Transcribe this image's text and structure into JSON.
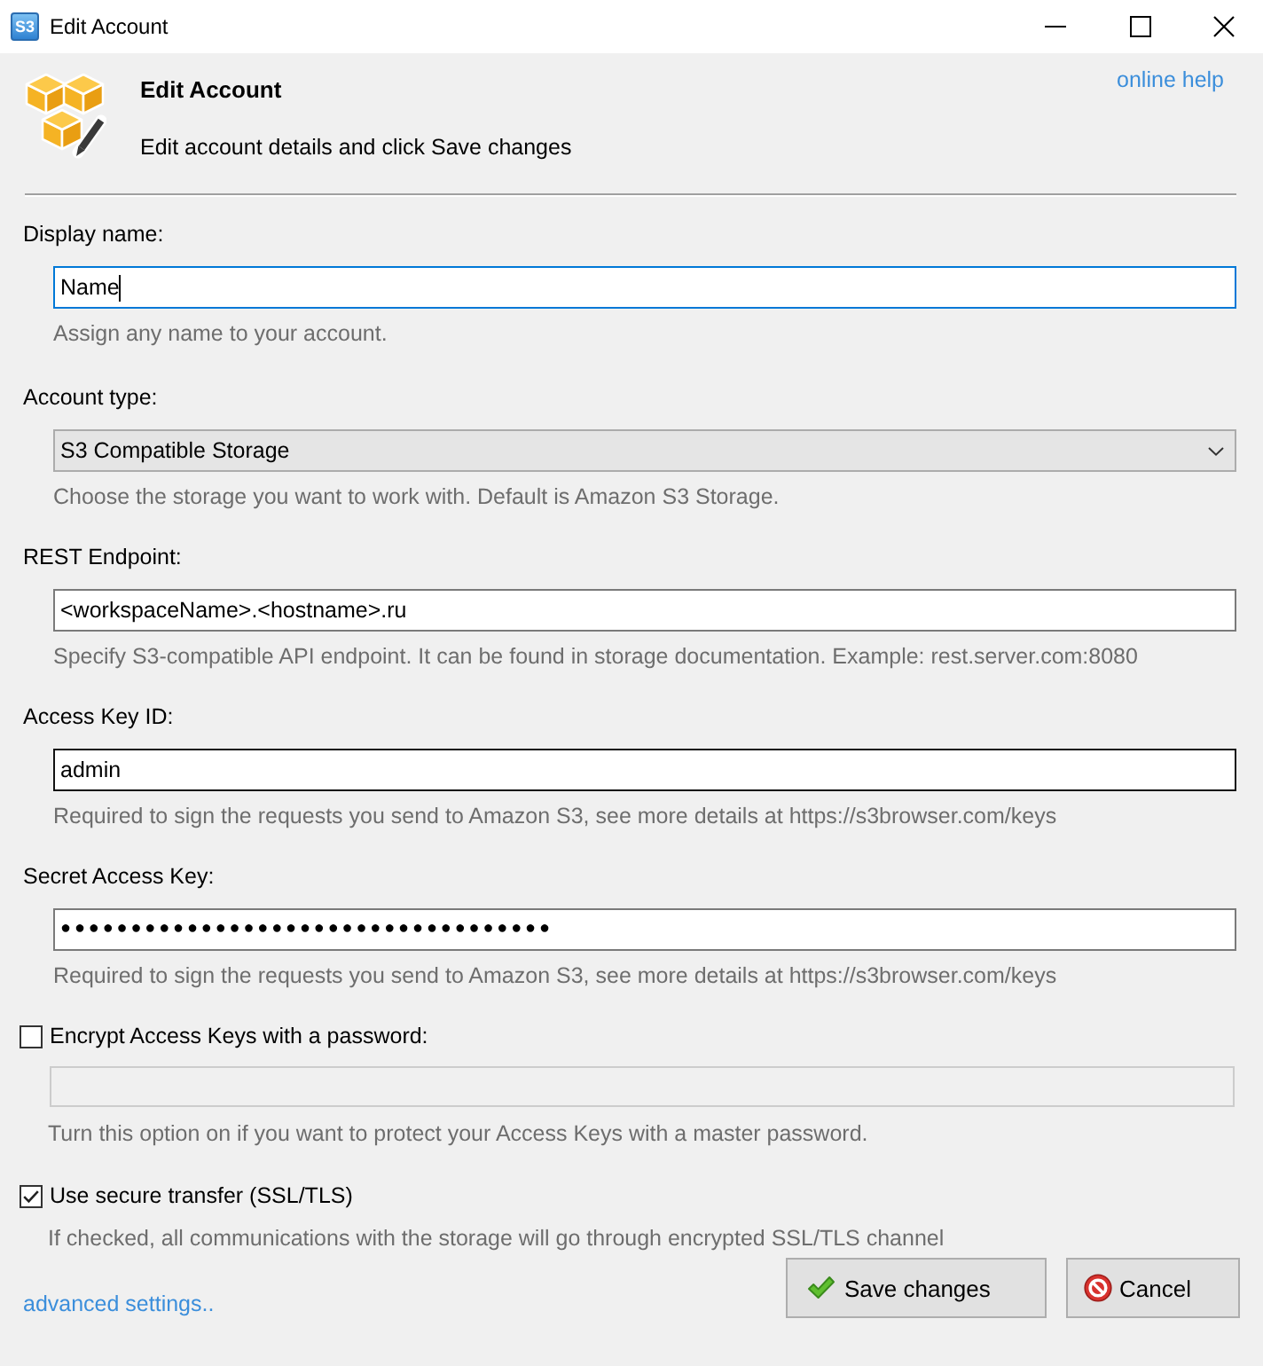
{
  "window": {
    "icon_text": "S3",
    "title": "Edit Account"
  },
  "header": {
    "title": "Edit Account",
    "subtitle": "Edit account details and click Save changes",
    "help_link": "online help"
  },
  "fields": [
    {
      "kind": "text",
      "label": "Display name:",
      "value": "Name",
      "focused": true,
      "hovered": false,
      "hint": "Assign any name to your account."
    },
    {
      "kind": "select",
      "label": "Account type:",
      "value": "S3 Compatible Storage",
      "hint": "Choose the storage you want to work with. Default is Amazon S3 Storage."
    },
    {
      "kind": "text",
      "label": "REST Endpoint:",
      "value": "<workspaceName>.<hostname>.ru",
      "focused": false,
      "hovered": false,
      "hint": "Specify S3-compatible API endpoint. It can be found in storage documentation. Example: rest.server.com:8080"
    },
    {
      "kind": "text",
      "label": "Access Key ID:",
      "value": "admin",
      "focused": false,
      "hovered": true,
      "hint": "Required to sign the requests you send to Amazon S3, see more details at https://s3browser.com/keys"
    },
    {
      "kind": "password",
      "label": "Secret Access Key:",
      "value": "●●●●●●●●●●●●●●●●●●●●●●●●●●●●●●●●●●●",
      "focused": false,
      "hovered": false,
      "hint": "Required to sign the requests you send to Amazon S3, see more details at https://s3browser.com/keys"
    }
  ],
  "options": [
    {
      "label": "Encrypt Access Keys with a password:",
      "checked": false,
      "password_field": {
        "disabled": true
      },
      "hint": "Turn this option on if you want to protect your Access Keys with a master password."
    },
    {
      "label": "Use secure transfer (SSL/TLS)",
      "checked": true,
      "hint": "If checked, all communications with the storage will go through encrypted SSL/TLS channel"
    }
  ],
  "footer": {
    "link": "advanced settings..",
    "buttons": [
      {
        "kind": "save",
        "label": "Save changes"
      },
      {
        "kind": "cancel",
        "label": "Cancel"
      }
    ]
  }
}
